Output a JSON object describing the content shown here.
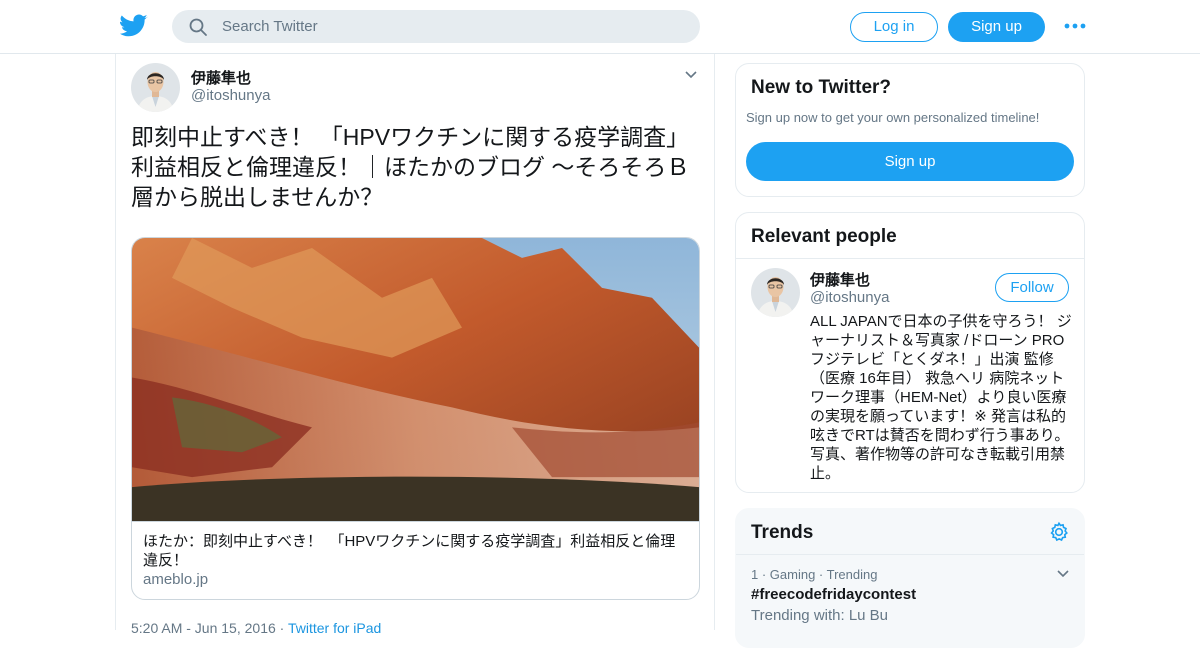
{
  "header": {
    "logo_icon": "twitter-bird-icon",
    "search_placeholder": "Search Twitter",
    "login_label": "Log in",
    "signup_label": "Sign up",
    "more_icon": "more-dots-icon",
    "accent_color": "#1da1f2"
  },
  "tweet": {
    "author_name": "伊藤隼也",
    "author_handle": "@itoshunya",
    "text": "即刻中止すべき！ 「HPVワクチンに関する疫学調査」利益相反と倫理違反！｜ほたかのブログ ～そろそろＢ層から脱出しませんか？",
    "card": {
      "title": "ほたか：即刻中止すべき！　「HPVワクチンに関する疫学調査」利益相反と倫理違反！",
      "domain": "ameblo.jp"
    },
    "time": "5:20 AM - Jun 15, 2016 · ",
    "source": "Twitter for iPad"
  },
  "new_to_twitter": {
    "title": "New to Twitter?",
    "subtitle": "Sign up now to get your own personalized timeline!",
    "button_label": "Sign up"
  },
  "relevant_people": {
    "title": "Relevant people",
    "name": "伊藤隼也",
    "handle": "@itoshunya",
    "follow_label": "Follow",
    "bio": "ALL JAPANで日本の子供を守ろう！ ジャーナリスト＆写真家 /ドローン PRO フジテレビ「とくダネ！」出演 監修（医療 16年目） 救急ヘリ 病院ネットワーク理事（HEM-Net）より良い医療の実現を願っています！※ 発言は私的呟きでRTは賛否を問わず行う事あり。写真、著作物等の許可なき転載引用禁止。"
  },
  "trends": {
    "title": "Trends",
    "items": [
      {
        "meta": "1 · Gaming · Trending",
        "name": "#freecodefridaycontest",
        "with": "Trending with: Lu Bu"
      }
    ]
  }
}
